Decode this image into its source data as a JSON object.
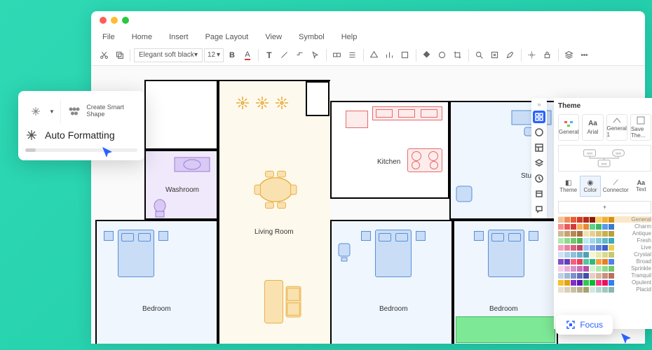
{
  "menu": {
    "file": "File",
    "home": "Home",
    "insert": "Insert",
    "pagelayout": "Page Layout",
    "view": "View",
    "symbol": "Symbol",
    "help": "Help"
  },
  "toolbar": {
    "font": "Elegant soft black",
    "size": "12"
  },
  "callout": {
    "create_smart": "Create Smart Shape",
    "auto_formatting": "Auto Formatting"
  },
  "rooms": {
    "washroom": "Washroom",
    "livingroom": "Living Room",
    "kitchen": "Kitchen",
    "bedroom": "Bedroom",
    "study": "Study"
  },
  "theme": {
    "title": "Theme",
    "presets": [
      {
        "icon": "general",
        "label": "General"
      },
      {
        "icon": "font",
        "label": "Arial"
      },
      {
        "icon": "general1",
        "label": "General 1"
      },
      {
        "icon": "save",
        "label": "Save The..."
      }
    ],
    "tabs": {
      "theme": "Theme",
      "color": "Color",
      "connector": "Connector",
      "text": "Text"
    },
    "schemes": [
      "General",
      "Charm",
      "Antique",
      "Fresh",
      "Live",
      "Crystal",
      "Broad",
      "Sprinkle",
      "Tranquil",
      "Opulent",
      "Placid"
    ]
  },
  "focus": {
    "label": "Focus"
  }
}
